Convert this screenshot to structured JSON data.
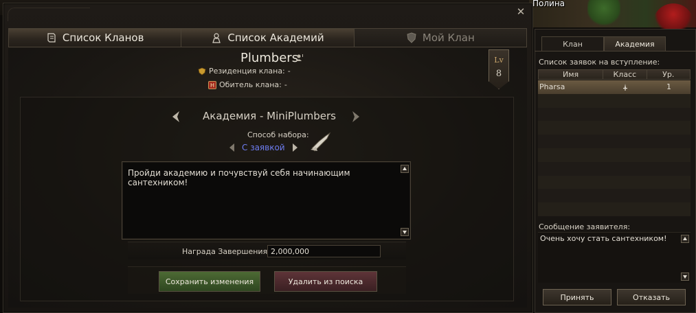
{
  "scene": {
    "player_name": "Полина"
  },
  "tabs": [
    {
      "label": "Список Кланов",
      "icon": "scroll-icon",
      "active": true
    },
    {
      "label": "Список Академий",
      "icon": "academy-icon",
      "active": true
    },
    {
      "label": "Мой Клан",
      "icon": "shield-icon",
      "active": false
    }
  ],
  "clan": {
    "name": "Plumbers",
    "residence_label": "Резиденция клана:",
    "residence_value": "-",
    "abode_label": "Обитель клана:",
    "abode_value": "-",
    "level_label": "Lv",
    "level": "8"
  },
  "academy": {
    "title": "Академия - MiniPlumbers",
    "method_label": "Способ набора:",
    "method_value": "С заявкой",
    "message": "Пройди академию и почувствуй себя начинающим сантехником!",
    "reward_label": "Награда Завершения:",
    "reward_value": "2,000,000",
    "save_button": "Сохранить изменения",
    "delete_button": "Удалить из поиска"
  },
  "side": {
    "tabs": [
      {
        "label": "Клан",
        "active": false
      },
      {
        "label": "Академия",
        "active": true
      }
    ],
    "requests_title": "Список заявок на вступление:",
    "columns": [
      "Имя",
      "Класс",
      "Ур."
    ],
    "rows": [
      {
        "name": "Pharsa",
        "class_icon": "dagger-icon",
        "level": "1"
      }
    ],
    "empty_rows": 9,
    "applicant_message_title": "Сообщение заявителя:",
    "applicant_message": "Очень хочу стать сантехником!",
    "accept_button": "Принять",
    "reject_button": "Отказать"
  },
  "colors": {
    "method_value": "#6d7cf0",
    "save_button": "#3f5a2a",
    "delete_button": "#4c2a2d",
    "selected_row": "#5a4c38"
  }
}
